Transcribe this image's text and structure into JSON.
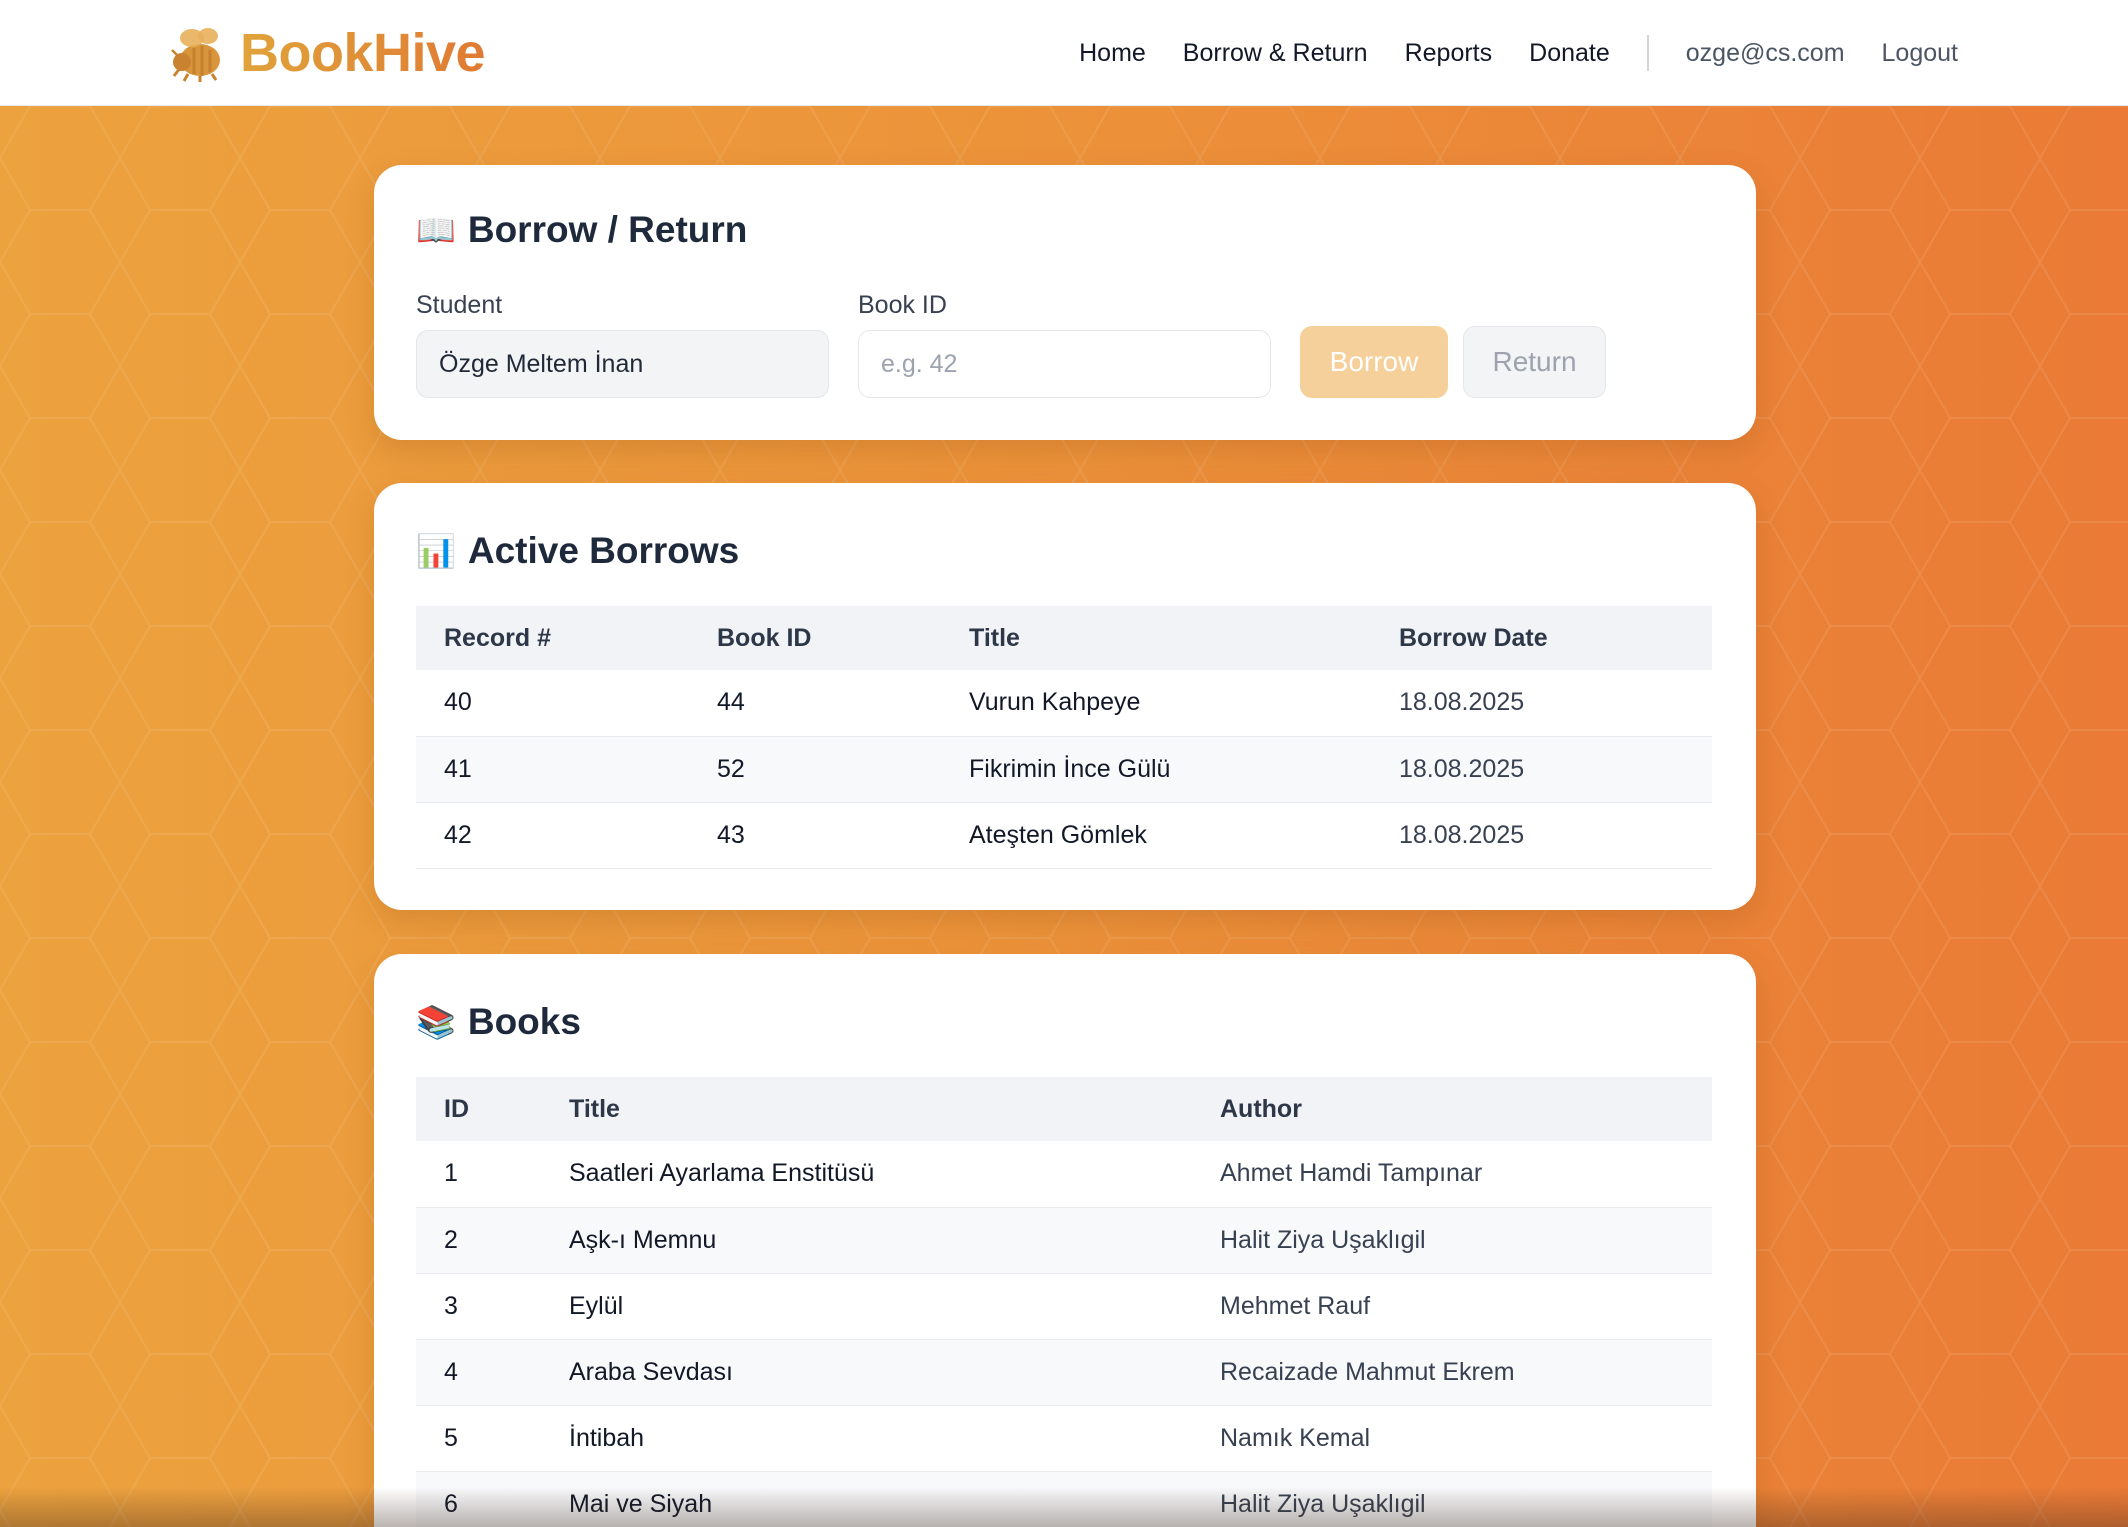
{
  "brand": {
    "name": "BookHive",
    "icon": "bee-icon"
  },
  "nav": {
    "home": "Home",
    "borrow_return": "Borrow & Return",
    "reports": "Reports",
    "donate": "Donate",
    "user_email": "ozge@cs.com",
    "logout": "Logout"
  },
  "borrow_card": {
    "title": "Borrow / Return",
    "icon": "open-book-icon",
    "student_label": "Student",
    "student_value": "Özge Meltem İnan",
    "book_id_label": "Book ID",
    "book_id_value": "",
    "book_id_placeholder": "e.g. 42",
    "borrow_button": "Borrow",
    "return_button": "Return"
  },
  "active_borrows": {
    "title": "Active Borrows",
    "icon": "bar-chart-icon",
    "columns": [
      "Record #",
      "Book ID",
      "Title",
      "Borrow Date"
    ],
    "rows": [
      {
        "record": "40",
        "book_id": "44",
        "title": "Vurun Kahpeye",
        "date": "18.08.2025"
      },
      {
        "record": "41",
        "book_id": "52",
        "title": "Fikrimin İnce Gülü",
        "date": "18.08.2025"
      },
      {
        "record": "42",
        "book_id": "43",
        "title": "Ateşten Gömlek",
        "date": "18.08.2025"
      }
    ]
  },
  "books": {
    "title": "Books",
    "icon": "books-stack-icon",
    "columns": [
      "ID",
      "Title",
      "Author"
    ],
    "rows": [
      {
        "id": "1",
        "title": "Saatleri Ayarlama Enstitüsü",
        "author": "Ahmet Hamdi Tampınar"
      },
      {
        "id": "2",
        "title": "Aşk-ı Memnu",
        "author": "Halit Ziya Uşaklıgil"
      },
      {
        "id": "3",
        "title": "Eylül",
        "author": "Mehmet Rauf"
      },
      {
        "id": "4",
        "title": "Araba Sevdası",
        "author": "Recaizade Mahmut Ekrem"
      },
      {
        "id": "5",
        "title": "İntibah",
        "author": "Namık Kemal"
      },
      {
        "id": "6",
        "title": "Mai ve Siyah",
        "author": "Halit Ziya Uşaklıgil"
      }
    ]
  },
  "colors": {
    "brand_gradient_start": "#e0a33a",
    "brand_gradient_end": "#e07a34",
    "background_start": "#eca23e",
    "background_end": "#ea7a36",
    "borrow_button": "#f6d09a"
  }
}
